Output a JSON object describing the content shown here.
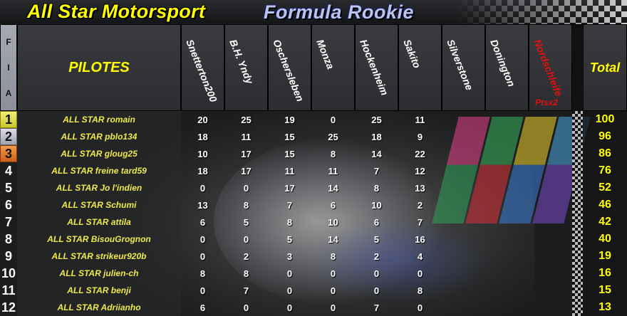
{
  "header": {
    "brand": "All Star Motorsport",
    "series": "Formula Rookie"
  },
  "table": {
    "fia_letters": [
      "F",
      "I",
      "A"
    ],
    "pilots_header": "PILOTES",
    "races": [
      {
        "name": "Snetterton200",
        "highlight": false
      },
      {
        "name": "B.H. Yndy",
        "highlight": false
      },
      {
        "name": "Oschersleben",
        "highlight": false
      },
      {
        "name": "Monza",
        "highlight": false
      },
      {
        "name": "Hockenheim",
        "highlight": false
      },
      {
        "name": "Sakito",
        "highlight": false
      },
      {
        "name": "Silverstone",
        "highlight": false
      },
      {
        "name": "Donington",
        "highlight": false
      },
      {
        "name": "Nordschleife",
        "highlight": true
      }
    ],
    "bonus_note": "Ptsx2",
    "total_header": "Total",
    "rows": [
      {
        "rank": "1",
        "pilot": "ALL STAR romain",
        "points": [
          "20",
          "25",
          "19",
          "0",
          "25",
          "11",
          "",
          "",
          ""
        ],
        "total": "100"
      },
      {
        "rank": "2",
        "pilot": "ALL STAR pblo134",
        "points": [
          "18",
          "11",
          "15",
          "25",
          "18",
          "9",
          "",
          "",
          ""
        ],
        "total": "96"
      },
      {
        "rank": "3",
        "pilot": "ALL STAR gloug25",
        "points": [
          "10",
          "17",
          "15",
          "8",
          "14",
          "22",
          "",
          "",
          ""
        ],
        "total": "86"
      },
      {
        "rank": "4",
        "pilot": "ALL STAR freine tard59",
        "points": [
          "18",
          "17",
          "11",
          "11",
          "7",
          "12",
          "",
          "",
          ""
        ],
        "total": "76"
      },
      {
        "rank": "5",
        "pilot": "ALL STAR Jo l'indien",
        "points": [
          "0",
          "0",
          "17",
          "14",
          "8",
          "13",
          "",
          "",
          ""
        ],
        "total": "52"
      },
      {
        "rank": "6",
        "pilot": "ALL STAR Schumi",
        "points": [
          "13",
          "8",
          "7",
          "6",
          "10",
          "2",
          "",
          "",
          ""
        ],
        "total": "46"
      },
      {
        "rank": "7",
        "pilot": "ALL STAR attila",
        "points": [
          "6",
          "5",
          "8",
          "10",
          "6",
          "7",
          "",
          "",
          ""
        ],
        "total": "42"
      },
      {
        "rank": "8",
        "pilot": "ALL STAR BisouGrognon",
        "points": [
          "0",
          "0",
          "5",
          "14",
          "5",
          "16",
          "",
          "",
          ""
        ],
        "total": "40"
      },
      {
        "rank": "9",
        "pilot": "ALL STAR strikeur920b",
        "points": [
          "0",
          "2",
          "3",
          "8",
          "2",
          "4",
          "",
          "",
          ""
        ],
        "total": "19"
      },
      {
        "rank": "10",
        "pilot": "ALL STAR julien-ch",
        "points": [
          "8",
          "8",
          "0",
          "0",
          "0",
          "0",
          "",
          "",
          ""
        ],
        "total": "16"
      },
      {
        "rank": "11",
        "pilot": "ALL STAR benji",
        "points": [
          "0",
          "7",
          "0",
          "0",
          "0",
          "8",
          "",
          "",
          ""
        ],
        "total": "15"
      },
      {
        "rank": "12",
        "pilot": "ALL STAR Adriianho",
        "points": [
          "6",
          "0",
          "0",
          "0",
          "7",
          "0",
          "",
          "",
          ""
        ],
        "total": "13"
      }
    ]
  },
  "colors": {
    "title_yellow": "#ffff00",
    "series_blue": "#b7c4f2",
    "highlight_red": "#e01010",
    "gold": "#e6e24a",
    "silver": "#c4c6d2",
    "bronze": "#e37a2c"
  }
}
